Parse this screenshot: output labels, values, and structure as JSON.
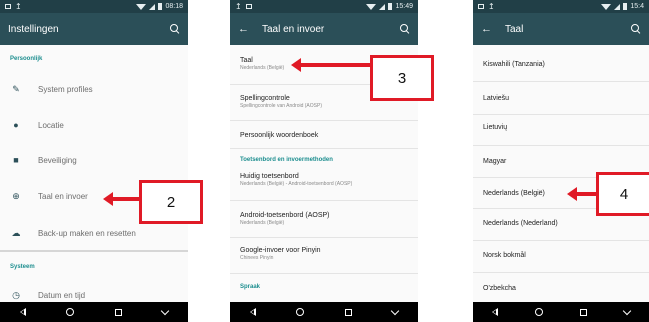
{
  "screen1": {
    "status_time": "08:18",
    "title": "Instellingen",
    "section_personal": "Persoonlijk",
    "items": [
      {
        "label": "System profiles",
        "icon": "profiles-icon"
      },
      {
        "label": "Locatie",
        "icon": "location-icon"
      },
      {
        "label": "Beveiliging",
        "icon": "lock-icon"
      },
      {
        "label": "Taal en invoer",
        "icon": "globe-icon"
      },
      {
        "label": "Back-up maken en resetten",
        "icon": "cloud-upload-icon"
      }
    ],
    "section_system": "Systeem",
    "last_item": {
      "label": "Datum en tijd",
      "icon": "clock-icon"
    },
    "callout": "2"
  },
  "screen2": {
    "status_time": "15:49",
    "title": "Taal en invoer",
    "items": [
      {
        "title": "Taal",
        "subtitle": "Nederlands (België)"
      },
      {
        "title": "Spellingcontrole",
        "subtitle": "Spellingcontrole van Android (AOSP)"
      },
      {
        "title": "Persoonlijk woordenboek",
        "subtitle": ""
      }
    ],
    "section_keyboards": "Toetsenbord en invoermethoden",
    "keyboard_items": [
      {
        "title": "Huidig toetsenbord",
        "subtitle": "Nederlands (België) - Android-toetsenbord (AOSP)"
      },
      {
        "title": "Android-toetsenbord (AOSP)",
        "subtitle": "Nederlands (België)"
      },
      {
        "title": "Google-invoer voor Pinyin",
        "subtitle": "Chinees Pinyin"
      }
    ],
    "section_speech": "Spraak",
    "callout": "3"
  },
  "screen3": {
    "status_time": "15:4",
    "title": "Taal",
    "languages": [
      "Kiswahili (Tanzania)",
      "Latviešu",
      "Lietuvių",
      "Magyar",
      "Nederlands (België)",
      "Nederlands (Nederland)",
      "Norsk bokmål",
      "O'zbekcha"
    ],
    "callout": "4"
  },
  "colors": {
    "statusbar": "#213f47",
    "appbar": "#2b4f58",
    "accent": "#1d8e8f",
    "callout_red": "#e01a26"
  }
}
